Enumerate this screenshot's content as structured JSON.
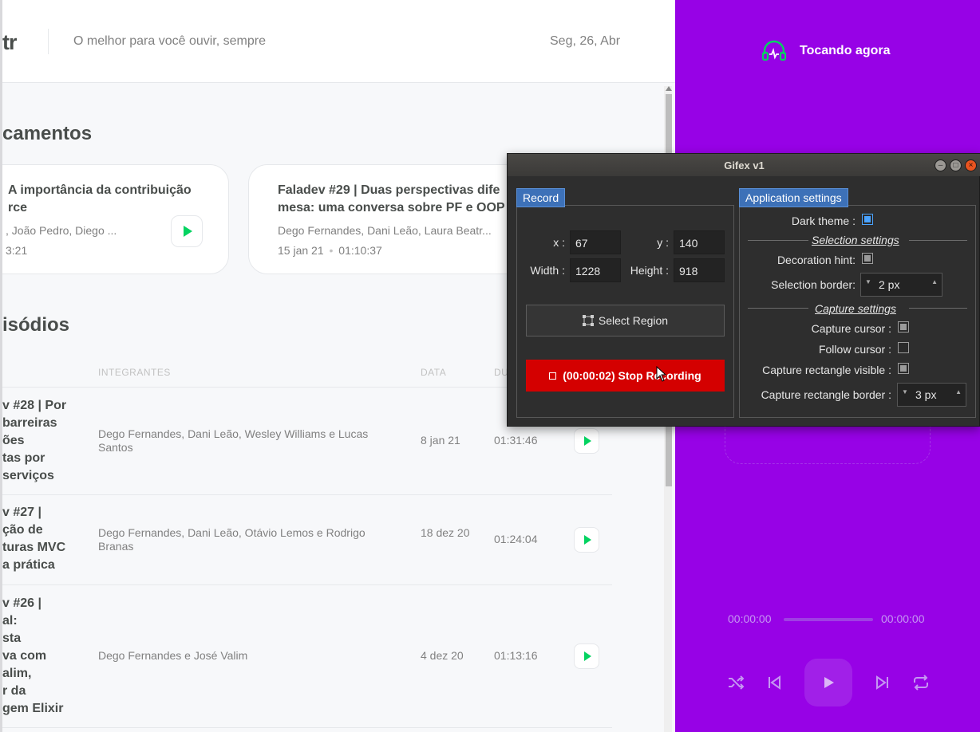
{
  "header": {
    "logo_text": "tr",
    "tagline": "O melhor para você ouvir, sempre",
    "date": "Seg, 26, Abr"
  },
  "latest": {
    "title": "camentos",
    "cards": [
      {
        "title_line1": "A importância da contribuição",
        "title_line2": "rce",
        "members": ", João Pedro, Diego ...",
        "meta": "3:21"
      },
      {
        "title_line1": "Faladev #29 | Duas perspectivas dife",
        "title_line2": "mesa: uma conversa sobre PF e OOP",
        "members": "Dego Fernandes, Dani Leão, Laura Beatr...",
        "date": "15 jan 21",
        "separator": "•",
        "duration": "01:10:37"
      }
    ]
  },
  "all": {
    "title": "isódios",
    "columns": {
      "members": "INTEGRANTES",
      "date": "DATA",
      "duration": "DU"
    },
    "rows": [
      {
        "title_lines": [
          "v #28 | Por",
          "barreiras",
          "ões",
          "tas por",
          "serviços"
        ],
        "members": "Dego Fernandes, Dani Leão, Wesley Williams e Lucas Santos",
        "date": "8 jan 21",
        "duration": "01:31:46"
      },
      {
        "title_lines": [
          "v #27 |",
          "ção de",
          "turas MVC",
          "a prática"
        ],
        "members": "Dego Fernandes, Dani Leão, Otávio Lemos e Rodrigo Branas",
        "date": "18 dez 20",
        "duration": "01:24:04"
      },
      {
        "title_lines": [
          "v #26 |",
          "al:",
          "sta",
          "va com",
          "alim,",
          "r da",
          "gem Elixir"
        ],
        "members": "Dego Fernandes e José Valim",
        "date": "4 dez 20",
        "duration": "01:13:16"
      }
    ]
  },
  "player": {
    "title": "Tocando agora",
    "time_current": "00:00:00",
    "time_total": "00:00:00",
    "colors": {
      "background": "#9702e6",
      "accent": "#04d361"
    }
  },
  "gifex": {
    "title": "Gifex v1",
    "record_tab": "Record",
    "x_label": "x :",
    "x_value": "67",
    "y_label": "y :",
    "y_value": "140",
    "width_label": "Width :",
    "width_value": "1228",
    "height_label": "Height :",
    "height_value": "918",
    "select_region": "Select Region",
    "stop_recording": "(00:00:02) Stop Recording",
    "settings_tab": "Application settings",
    "dark_theme": "Dark theme :",
    "selection_settings": "Selection settings",
    "decoration_hint": "Decoration hint:",
    "selection_border": "Selection border:",
    "selection_border_value": "2 px",
    "capture_settings": "Capture settings",
    "capture_cursor": "Capture cursor :",
    "follow_cursor": "Follow cursor :",
    "capture_rect_visible": "Capture rectangle visible :",
    "capture_rect_border": "Capture rectangle border :",
    "capture_rect_border_value": "3 px",
    "checks": {
      "dark_theme": true,
      "decoration_hint": true,
      "capture_cursor": true,
      "follow_cursor": false,
      "capture_rect_visible": true
    }
  }
}
